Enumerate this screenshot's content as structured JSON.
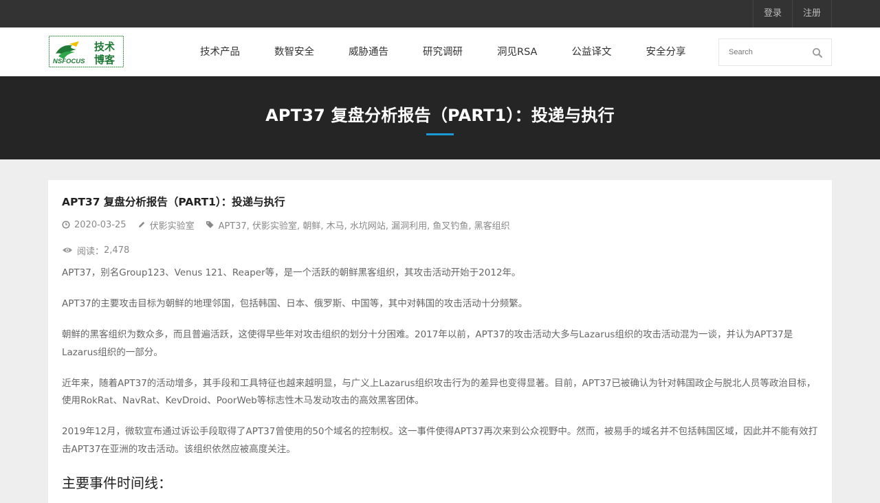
{
  "topbar": {
    "login": "登录",
    "register": "注册"
  },
  "logo": {
    "brand": "NSFOCUS",
    "title_line1": "技术",
    "title_line2": "博客"
  },
  "nav": [
    {
      "label": "技术产品"
    },
    {
      "label": "数智安全"
    },
    {
      "label": "威胁通告"
    },
    {
      "label": "研究调研"
    },
    {
      "label": "洞见RSA"
    },
    {
      "label": "公益译文"
    },
    {
      "label": "安全分享"
    }
  ],
  "search": {
    "placeholder": "Search"
  },
  "banner": {
    "title": "APT37 复盘分析报告（PART1）：投递与执行"
  },
  "article": {
    "title": "APT37 复盘分析报告（PART1）：投递与执行",
    "date": "2020-03-25",
    "author": "伏影实验室",
    "tags": "APT37, 伏影实验室, 朝鲜, 木马, 水坑网站, 漏洞利用, 鱼叉钓鱼, 黑客组织",
    "views_label": "阅读：",
    "views_count": "2,478",
    "paragraphs": [
      "APT37，别名Group123、Venus 121、Reaper等，是一个活跃的朝鲜黑客组织，其攻击活动开始于2012年。",
      "APT37的主要攻击目标为朝鲜的地理邻国，包括韩国、日本、俄罗斯、中国等，其中对韩国的攻击活动十分频繁。",
      "朝鲜的黑客组织为数众多，而且普遍活跃，这使得早些年对攻击组织的划分十分困难。2017年以前，APT37的攻击活动大多与Lazarus组织的攻击活动混为一谈，并认为APT37是Lazarus组织的一部分。",
      "近年来，随着APT37的活动增多，其手段和工具特征也越来越明显，与广义上Lazarus组织攻击行为的差异也变得显著。目前，APT37已被确认为针对韩国政企与脱北人员等政治目标，使用RokRat、NavRat、KevDroid、PoorWeb等标志性木马发动攻击的高效黑客团体。",
      "2019年12月，微软宣布通过诉讼手段取得了APT37曾使用的50个域名的控制权。这一事件使得APT37再次来到公众视野中。然而，被易手的域名并不包括韩国区域，因此并不能有效打击APT37在亚洲的攻击活动。该组织依然应被高度关注。"
    ],
    "section_heading": "主要事件时间线："
  },
  "colors": {
    "accent": "#1a9ad6",
    "logo_green": "#1e7a35"
  }
}
